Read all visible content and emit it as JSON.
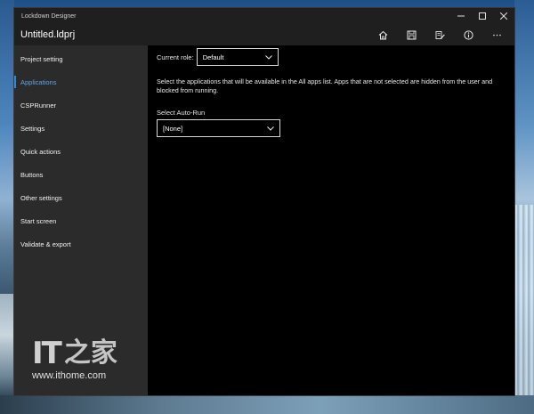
{
  "window": {
    "title": "Lockdown Designer",
    "controls": {
      "minimize": "—",
      "maximize": "☐",
      "close": "✕"
    }
  },
  "appbar": {
    "document_name": "Untitled.ldprj",
    "icons": [
      "home-icon",
      "save-icon",
      "edit-icon",
      "info-icon",
      "more-icon"
    ],
    "more_label": "···"
  },
  "nav": {
    "items": [
      {
        "label": "Project setting",
        "active": false
      },
      {
        "label": "Applications",
        "active": true
      },
      {
        "label": "CSPRunner",
        "active": false
      },
      {
        "label": "Settings",
        "active": false
      },
      {
        "label": "Quick actions",
        "active": false
      },
      {
        "label": "Buttons",
        "active": false
      },
      {
        "label": "Other settings",
        "active": false
      },
      {
        "label": "Start screen",
        "active": false
      },
      {
        "label": "Validate & export",
        "active": false
      }
    ]
  },
  "main": {
    "role_label": "Current role:",
    "role_value": "Default",
    "description": "Select the applications that will be available in the All apps list. Apps that are not selected are hidden from the user and blocked from running.",
    "autorun_label": "Select Auto-Run",
    "autorun_value": "[None]"
  },
  "watermark": {
    "logo_latin": "IT",
    "logo_cjk": "之家",
    "url": "www.ithome.com"
  },
  "colors": {
    "accent": "#2e8ae0",
    "nav_background": "#2b2b2b",
    "content_background": "#000000",
    "titlebar": "#1f1f1f"
  }
}
